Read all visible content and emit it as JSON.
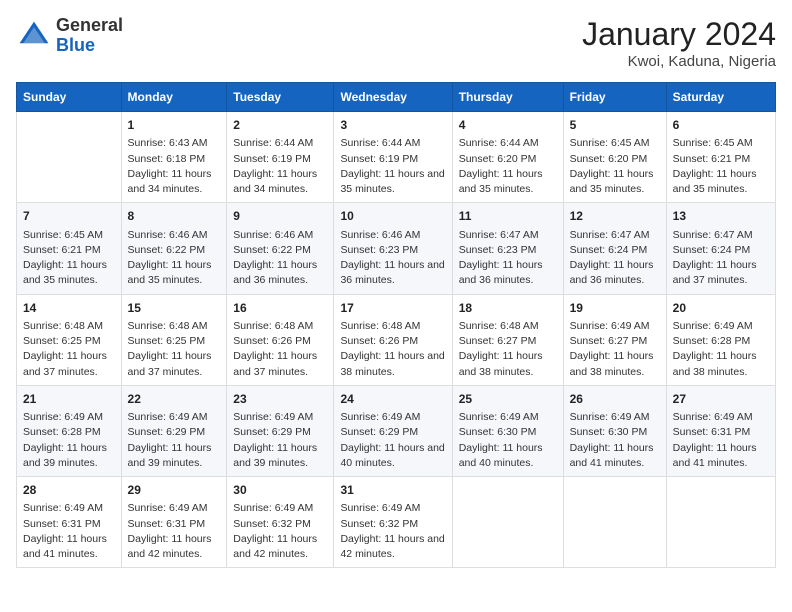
{
  "header": {
    "logo_general": "General",
    "logo_blue": "Blue",
    "month": "January 2024",
    "location": "Kwoi, Kaduna, Nigeria"
  },
  "weekdays": [
    "Sunday",
    "Monday",
    "Tuesday",
    "Wednesday",
    "Thursday",
    "Friday",
    "Saturday"
  ],
  "weeks": [
    [
      {
        "day": "",
        "sunrise": "",
        "sunset": "",
        "daylight": ""
      },
      {
        "day": "1",
        "sunrise": "Sunrise: 6:43 AM",
        "sunset": "Sunset: 6:18 PM",
        "daylight": "Daylight: 11 hours and 34 minutes."
      },
      {
        "day": "2",
        "sunrise": "Sunrise: 6:44 AM",
        "sunset": "Sunset: 6:19 PM",
        "daylight": "Daylight: 11 hours and 34 minutes."
      },
      {
        "day": "3",
        "sunrise": "Sunrise: 6:44 AM",
        "sunset": "Sunset: 6:19 PM",
        "daylight": "Daylight: 11 hours and 35 minutes."
      },
      {
        "day": "4",
        "sunrise": "Sunrise: 6:44 AM",
        "sunset": "Sunset: 6:20 PM",
        "daylight": "Daylight: 11 hours and 35 minutes."
      },
      {
        "day": "5",
        "sunrise": "Sunrise: 6:45 AM",
        "sunset": "Sunset: 6:20 PM",
        "daylight": "Daylight: 11 hours and 35 minutes."
      },
      {
        "day": "6",
        "sunrise": "Sunrise: 6:45 AM",
        "sunset": "Sunset: 6:21 PM",
        "daylight": "Daylight: 11 hours and 35 minutes."
      }
    ],
    [
      {
        "day": "7",
        "sunrise": "Sunrise: 6:45 AM",
        "sunset": "Sunset: 6:21 PM",
        "daylight": "Daylight: 11 hours and 35 minutes."
      },
      {
        "day": "8",
        "sunrise": "Sunrise: 6:46 AM",
        "sunset": "Sunset: 6:22 PM",
        "daylight": "Daylight: 11 hours and 35 minutes."
      },
      {
        "day": "9",
        "sunrise": "Sunrise: 6:46 AM",
        "sunset": "Sunset: 6:22 PM",
        "daylight": "Daylight: 11 hours and 36 minutes."
      },
      {
        "day": "10",
        "sunrise": "Sunrise: 6:46 AM",
        "sunset": "Sunset: 6:23 PM",
        "daylight": "Daylight: 11 hours and 36 minutes."
      },
      {
        "day": "11",
        "sunrise": "Sunrise: 6:47 AM",
        "sunset": "Sunset: 6:23 PM",
        "daylight": "Daylight: 11 hours and 36 minutes."
      },
      {
        "day": "12",
        "sunrise": "Sunrise: 6:47 AM",
        "sunset": "Sunset: 6:24 PM",
        "daylight": "Daylight: 11 hours and 36 minutes."
      },
      {
        "day": "13",
        "sunrise": "Sunrise: 6:47 AM",
        "sunset": "Sunset: 6:24 PM",
        "daylight": "Daylight: 11 hours and 37 minutes."
      }
    ],
    [
      {
        "day": "14",
        "sunrise": "Sunrise: 6:48 AM",
        "sunset": "Sunset: 6:25 PM",
        "daylight": "Daylight: 11 hours and 37 minutes."
      },
      {
        "day": "15",
        "sunrise": "Sunrise: 6:48 AM",
        "sunset": "Sunset: 6:25 PM",
        "daylight": "Daylight: 11 hours and 37 minutes."
      },
      {
        "day": "16",
        "sunrise": "Sunrise: 6:48 AM",
        "sunset": "Sunset: 6:26 PM",
        "daylight": "Daylight: 11 hours and 37 minutes."
      },
      {
        "day": "17",
        "sunrise": "Sunrise: 6:48 AM",
        "sunset": "Sunset: 6:26 PM",
        "daylight": "Daylight: 11 hours and 38 minutes."
      },
      {
        "day": "18",
        "sunrise": "Sunrise: 6:48 AM",
        "sunset": "Sunset: 6:27 PM",
        "daylight": "Daylight: 11 hours and 38 minutes."
      },
      {
        "day": "19",
        "sunrise": "Sunrise: 6:49 AM",
        "sunset": "Sunset: 6:27 PM",
        "daylight": "Daylight: 11 hours and 38 minutes."
      },
      {
        "day": "20",
        "sunrise": "Sunrise: 6:49 AM",
        "sunset": "Sunset: 6:28 PM",
        "daylight": "Daylight: 11 hours and 38 minutes."
      }
    ],
    [
      {
        "day": "21",
        "sunrise": "Sunrise: 6:49 AM",
        "sunset": "Sunset: 6:28 PM",
        "daylight": "Daylight: 11 hours and 39 minutes."
      },
      {
        "day": "22",
        "sunrise": "Sunrise: 6:49 AM",
        "sunset": "Sunset: 6:29 PM",
        "daylight": "Daylight: 11 hours and 39 minutes."
      },
      {
        "day": "23",
        "sunrise": "Sunrise: 6:49 AM",
        "sunset": "Sunset: 6:29 PM",
        "daylight": "Daylight: 11 hours and 39 minutes."
      },
      {
        "day": "24",
        "sunrise": "Sunrise: 6:49 AM",
        "sunset": "Sunset: 6:29 PM",
        "daylight": "Daylight: 11 hours and 40 minutes."
      },
      {
        "day": "25",
        "sunrise": "Sunrise: 6:49 AM",
        "sunset": "Sunset: 6:30 PM",
        "daylight": "Daylight: 11 hours and 40 minutes."
      },
      {
        "day": "26",
        "sunrise": "Sunrise: 6:49 AM",
        "sunset": "Sunset: 6:30 PM",
        "daylight": "Daylight: 11 hours and 41 minutes."
      },
      {
        "day": "27",
        "sunrise": "Sunrise: 6:49 AM",
        "sunset": "Sunset: 6:31 PM",
        "daylight": "Daylight: 11 hours and 41 minutes."
      }
    ],
    [
      {
        "day": "28",
        "sunrise": "Sunrise: 6:49 AM",
        "sunset": "Sunset: 6:31 PM",
        "daylight": "Daylight: 11 hours and 41 minutes."
      },
      {
        "day": "29",
        "sunrise": "Sunrise: 6:49 AM",
        "sunset": "Sunset: 6:31 PM",
        "daylight": "Daylight: 11 hours and 42 minutes."
      },
      {
        "day": "30",
        "sunrise": "Sunrise: 6:49 AM",
        "sunset": "Sunset: 6:32 PM",
        "daylight": "Daylight: 11 hours and 42 minutes."
      },
      {
        "day": "31",
        "sunrise": "Sunrise: 6:49 AM",
        "sunset": "Sunset: 6:32 PM",
        "daylight": "Daylight: 11 hours and 42 minutes."
      },
      {
        "day": "",
        "sunrise": "",
        "sunset": "",
        "daylight": ""
      },
      {
        "day": "",
        "sunrise": "",
        "sunset": "",
        "daylight": ""
      },
      {
        "day": "",
        "sunrise": "",
        "sunset": "",
        "daylight": ""
      }
    ]
  ]
}
